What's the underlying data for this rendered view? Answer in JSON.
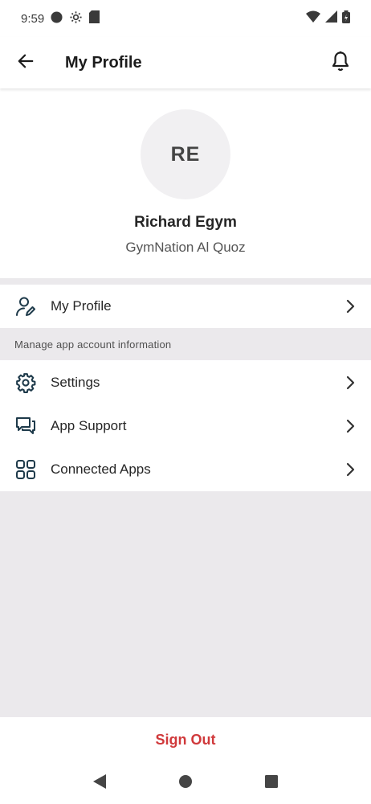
{
  "status_bar": {
    "time": "9:59",
    "icons_left": [
      "circle-icon",
      "settings-gear-icon",
      "sd-card-icon"
    ],
    "icons_right": [
      "wifi-icon",
      "signal-icon",
      "battery-icon"
    ]
  },
  "app_bar": {
    "title": "My Profile",
    "back_icon": "arrow-left-icon",
    "notification_icon": "bell-icon"
  },
  "profile": {
    "initials": "RE",
    "name": "Richard Egym",
    "gym": "GymNation Al Quoz"
  },
  "menu": {
    "profile_item": {
      "label": "My Profile",
      "icon": "user-edit-icon"
    },
    "section_header": "Manage app account information",
    "items": [
      {
        "label": "Settings",
        "icon": "gear-icon"
      },
      {
        "label": "App Support",
        "icon": "chat-icon"
      },
      {
        "label": "Connected Apps",
        "icon": "grid-icon"
      }
    ]
  },
  "footer": {
    "sign_out": "Sign Out"
  },
  "colors": {
    "accent_red": "#d0393b",
    "icon_dark": "#1e3a4a",
    "background_grey": "#ebe9ec"
  }
}
